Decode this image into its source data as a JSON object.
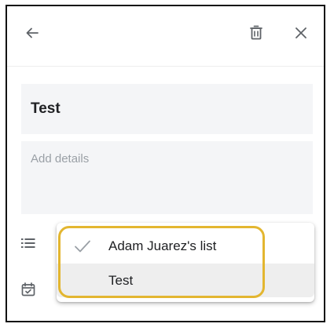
{
  "header": {
    "back_icon": "arrow-left-icon",
    "delete_icon": "trash-icon",
    "close_icon": "close-icon"
  },
  "task": {
    "title": "Test",
    "details_placeholder": "Add details"
  },
  "list_menu": {
    "items": [
      {
        "label": "Adam Juarez's list",
        "selected": true
      },
      {
        "label": "Test",
        "selected": false
      }
    ]
  },
  "colors": {
    "highlight": "#e3b630",
    "field_background": "#f4f5f7",
    "menu_hover": "#eeeeee"
  }
}
